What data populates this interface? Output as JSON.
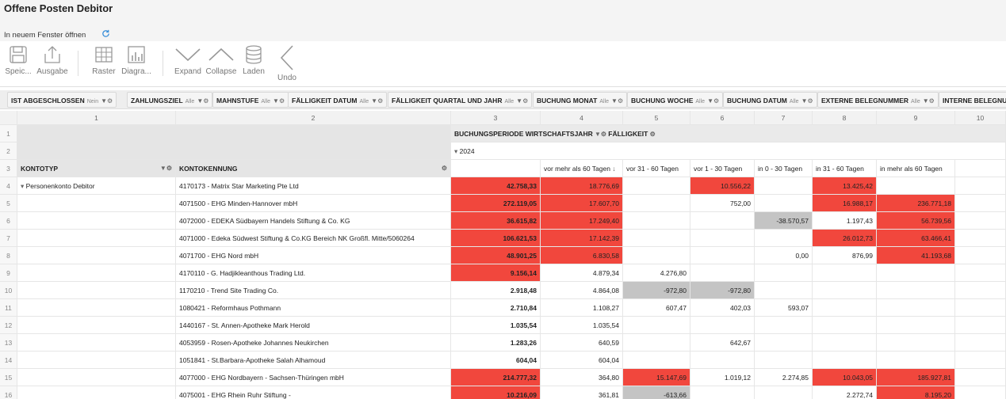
{
  "window": {
    "title": "Offene Posten Debitor",
    "open_new_window": "In neuem Fenster öffnen"
  },
  "toolbar": {
    "save": "Speic...",
    "output": "Ausgabe",
    "grid": "Raster",
    "diagram": "Diagra...",
    "expand": "Expand",
    "collapse": "Collapse",
    "load": "Laden",
    "undo": "Undo"
  },
  "filters": [
    {
      "label": "IST ABGESCHLOSSEN",
      "value": "Nein"
    },
    {
      "label": "ZAHLUNGSZIEL",
      "value": "Alle"
    },
    {
      "label": "MAHNSTUFE",
      "value": "Alle"
    },
    {
      "label": "FÄLLIGKEIT DATUM",
      "value": "Alle"
    },
    {
      "label": "FÄLLIGKEIT QUARTAL UND JAHR",
      "value": "Alle"
    },
    {
      "label": "BUCHUNG MONAT",
      "value": "Alle"
    },
    {
      "label": "BUCHUNG WOCHE",
      "value": "Alle"
    },
    {
      "label": "BUCHUNG DATUM",
      "value": "Alle"
    },
    {
      "label": "EXTERNE BELEGNUMMER",
      "value": "Alle"
    },
    {
      "label": "INTERNE BELEGNU",
      "value": ""
    }
  ],
  "columns": [
    "1",
    "2",
    "3",
    "4",
    "5",
    "6",
    "7",
    "8",
    "9",
    "10"
  ],
  "pivot": {
    "row_header_1": "KONTOTYP",
    "row_header_2": "KONTOKENNUNG",
    "col_header_1": "BUCHUNGSPERIODE WIRTSCHAFTSJAHR",
    "col_header_2": "FÄLLIGKEIT",
    "year": "2024",
    "buckets": [
      "vor mehr als 60 Tagen",
      "vor 31 - 60 Tagen",
      "vor 1 - 30 Tagen",
      "in 0 - 30 Tagen",
      "in 31 - 60 Tagen",
      "in mehr als 60 Tagen"
    ],
    "group_label": "Personenkonto Debitor"
  },
  "row_numbers": [
    "1",
    "2",
    "3",
    "4",
    "5",
    "6",
    "7",
    "8",
    "9",
    "10",
    "11",
    "12",
    "13",
    "14",
    "15",
    "16"
  ],
  "rows": [
    {
      "account": "4170173 - Matrix Star Marketing Pte Ltd",
      "total": "42.758,33",
      "v": [
        "18.776,69",
        "",
        "10.556,22",
        "",
        "13.425,42",
        ""
      ]
    },
    {
      "account": "4071500 - EHG Minden-Hannover mbH",
      "total": "272.119,05",
      "v": [
        "17.607,70",
        "",
        "752,00",
        "",
        "16.988,17",
        "236.771,18"
      ]
    },
    {
      "account": "4072000 - EDEKA Südbayern Handels Stiftung & Co. KG",
      "total": "36.615,82",
      "v": [
        "17.249,40",
        "",
        "",
        "-38.570,57",
        "1.197,43",
        "56.739,56"
      ]
    },
    {
      "account": "4071000 - Edeka Südwest Stiftung & Co.KG Bereich NK Großfl. Mitte/5060264",
      "total": "106.621,53",
      "v": [
        "17.142,39",
        "",
        "",
        "",
        "26.012,73",
        "63.466,41"
      ]
    },
    {
      "account": "4071700 - EHG Nord mbH",
      "total": "48.901,25",
      "v": [
        "6.830,58",
        "",
        "",
        "0,00",
        "876,99",
        "41.193,68"
      ]
    },
    {
      "account": "4170110 - G. Hadjikleanthous Trading Ltd.",
      "total": "9.156,14",
      "v": [
        "4.879,34",
        "4.276,80",
        "",
        "",
        "",
        ""
      ]
    },
    {
      "account": "1170210 - Trend Site Trading Co.",
      "total": "2.918,48",
      "v": [
        "4.864,08",
        "-972,80",
        "-972,80",
        "",
        "",
        ""
      ]
    },
    {
      "account": "1080421 - Reformhaus Pothmann",
      "total": "2.710,84",
      "v": [
        "1.108,27",
        "607,47",
        "402,03",
        "593,07",
        "",
        ""
      ]
    },
    {
      "account": "1440167 - St. Annen-Apotheke Mark Herold",
      "total": "1.035,54",
      "v": [
        "1.035,54",
        "",
        "",
        "",
        "",
        ""
      ]
    },
    {
      "account": "4053959 - Rosen-Apotheke Johannes Neukirchen",
      "total": "1.283,26",
      "v": [
        "640,59",
        "",
        "642,67",
        "",
        "",
        ""
      ]
    },
    {
      "account": "1051841 - St.Barbara-Apotheke Salah Alhamoud",
      "total": "604,04",
      "v": [
        "604,04",
        "",
        "",
        "",
        "",
        ""
      ]
    },
    {
      "account": "4077000 - EHG Nordbayern - Sachsen-Thüringen mbH",
      "total": "214.777,32",
      "v": [
        "364,80",
        "15.147,69",
        "1.019,12",
        "2.274,85",
        "10.043,05",
        "185.927,81"
      ]
    },
    {
      "account": "4075001 - EHG Rhein Ruhr Stiftung -",
      "total": "10.216,09",
      "v": [
        "361,81",
        "-613,66",
        "",
        "",
        "2.272,74",
        "8.195,20"
      ]
    }
  ],
  "colors": {
    "red": "#f1473d",
    "gray": "#c4c4c4",
    "accent": "#3a8fd9"
  }
}
